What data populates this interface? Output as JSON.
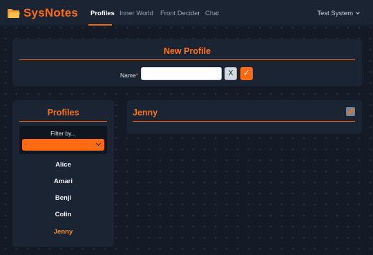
{
  "app": {
    "name": "SysNotes",
    "icon": "folder-open-icon",
    "accent_color": "#ff6a13"
  },
  "nav": {
    "items": [
      {
        "label": "Profiles",
        "active": true
      },
      {
        "label": "Inner World",
        "active": false
      },
      {
        "label": "Front Decider",
        "active": false
      },
      {
        "label": "Chat",
        "active": false
      }
    ],
    "user_menu": {
      "label": "Test System",
      "icon": "chevron-down-icon"
    }
  },
  "new_profile": {
    "title": "New Profile",
    "name_label": "Name",
    "required_mark": "*",
    "name_value": "",
    "clear_label": "X",
    "confirm_label": "✓"
  },
  "profiles_panel": {
    "title": "Profiles",
    "filter_label": "Filter by...",
    "filter_value": "-",
    "items": [
      {
        "name": "Alice",
        "selected": false
      },
      {
        "name": "Amari",
        "selected": false
      },
      {
        "name": "Benji",
        "selected": false
      },
      {
        "name": "Colin",
        "selected": false
      },
      {
        "name": "Jenny",
        "selected": true
      }
    ]
  },
  "detail": {
    "title": "Jenny",
    "edit_icon": "pencil-icon"
  }
}
